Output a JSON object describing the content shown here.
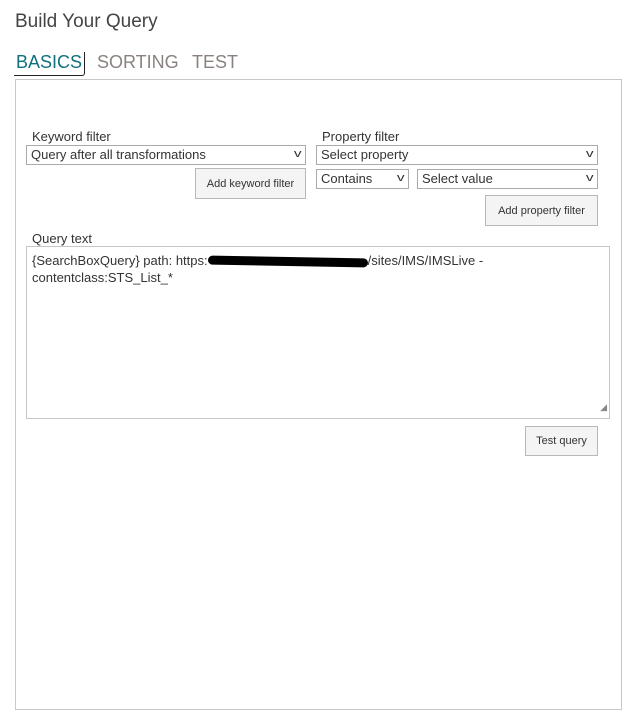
{
  "title": "Build Your Query",
  "tabs": [
    {
      "label": "BASICS",
      "active": true
    },
    {
      "label": "SORTING"
    },
    {
      "label": "TEST"
    }
  ],
  "keyword_filter": {
    "label": "Keyword filter",
    "selected": "Query after all transformations",
    "add_button": "Add keyword filter"
  },
  "property_filter": {
    "label": "Property filter",
    "property_selected": "Select property",
    "operator_selected": "Contains",
    "value_selected": "Select value",
    "add_button": "Add property filter"
  },
  "query_text": {
    "label": "Query text",
    "prefix": "{SearchBoxQuery} path: https:",
    "suffix": "/sites/IMS/IMSLive -",
    "line2": "contentclass:STS_List_*"
  },
  "test_button": "Test query",
  "colors": {
    "active_tab": "#10707c",
    "inactive_tab": "#8a8280"
  }
}
